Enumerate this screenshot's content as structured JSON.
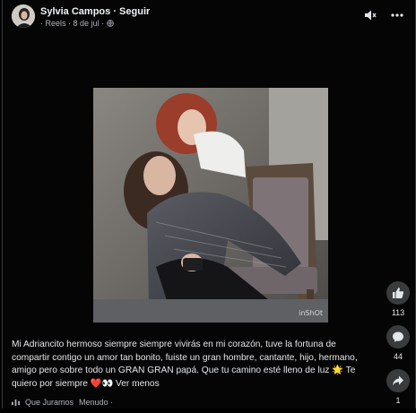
{
  "header": {
    "author": "Sylvia Campos",
    "separator": " · ",
    "follow": "Seguir",
    "meta_reels": "· Reels · 8 de jul ·"
  },
  "photo": {
    "watermark": "inShOt"
  },
  "actions": {
    "likes": "113",
    "comments": "44",
    "shares": "1"
  },
  "caption": {
    "text": "Mi Adriancito hermoso siempre siempre vivirás en mi corazón, tuve la fortuna de compartir contigo un amor tan bonito, fuiste un gran hombre, cantante, hijo, hermano, amigo pero sobre todo un GRAN GRAN papá. Que tu camino esté lleno de luz 🌟 Te quiero por siempre ❤️👀",
    "see_less": "Ver menos"
  },
  "music": {
    "track1": "Que Juramos",
    "track2": "Menudo ·"
  },
  "colors": {
    "background": "#000000",
    "text": "#e4e6eb",
    "secondary": "#b0b3b8",
    "button": "#3a3b3c"
  }
}
